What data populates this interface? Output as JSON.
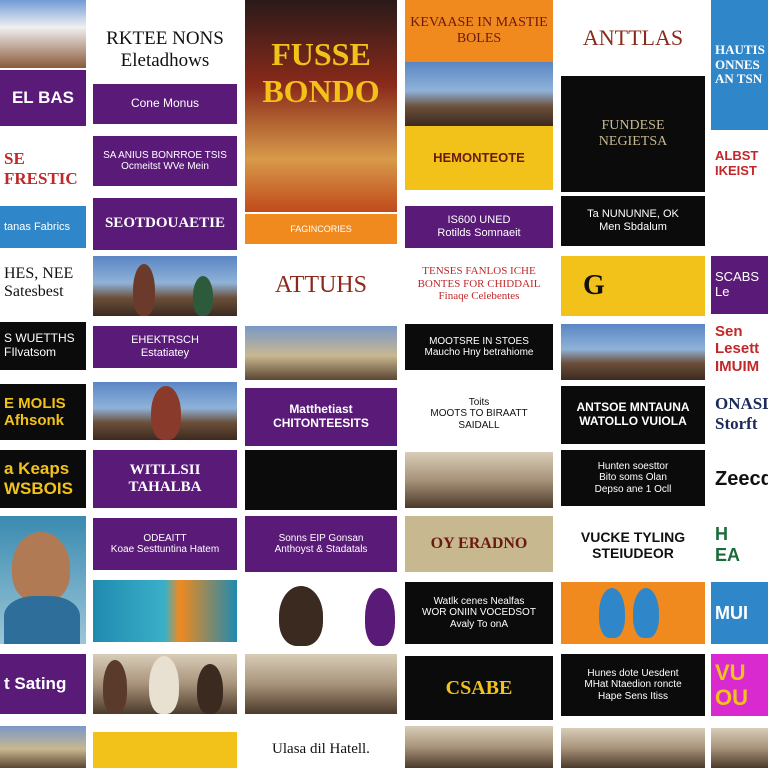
{
  "colors": {
    "purple": "#5a1a78",
    "black": "#0b0b0b",
    "orange": "#f08a1e",
    "yellow": "#f2c21a",
    "blue": "#2f86c8",
    "white": "#ffffff",
    "magenta": "#d92ad0"
  },
  "tiles": {
    "c1": [
      "EL BAS",
      "SE\nFRESTIC",
      "tanas Fabrics",
      "HES, NEE\nSatesbest",
      "S WUETTHS\nFIlvatsom",
      "E MOLIS\nAfhsonk",
      "a Keaps\nWSBOIS",
      "",
      "t Sating",
      ""
    ],
    "c2": [
      "RKTEE NONS\nEletadhows",
      "Cone Monus",
      "SA ANIUS BONRROE TSIS\nOcmeitst WVe Mein",
      "SEOTDOUAETIE",
      "",
      "EHEKTRSCH\nEstatiatey",
      "",
      "WITLLSII TAHALBA",
      "ODEAITT\nKoae Sesttuntina Hatem",
      "",
      "",
      ""
    ],
    "c3": [
      "FUSSE\nBONDO",
      "FAGINCORIES",
      "ATTUHS",
      "",
      "Matthetiast\nCHITONTEESITS",
      "",
      "Sonns EIP Gonsan\nAnthoyst & Stadatals",
      "",
      "Ulasa dil Hatell."
    ],
    "c4": [
      "KEVAASE IN MASTIE\nBOLES",
      "HEMONTEOTE",
      "IS600 UNED\nRotilds Somnaeit",
      "TENSES FANLOS ICHE\nBONTES FOR CHIDDAIL\nFinaqe Celebentes",
      "MOOTSRE IN STOES\nMaucho Hny betrahiome",
      "Toits\nMOOTS TO BIRAATT\nSAIDALL",
      "",
      "OY ERADNO",
      "Watlk cenes Nealfas\nWOR ONIIN VOCEDSOT\nAvaly To onA",
      "CSABE",
      ""
    ],
    "c5": [
      "ANTTLAS",
      "FUNDESE\nNEGIETSA",
      "Ta NUNUNNE, OK\nMen Sbdalum",
      "G",
      "",
      "ANTSOE MNTAUNA\nWATOLLO VUIOLA",
      "Hunten soesttor\nBito soms Olan\nDepso ane 1 Ocll",
      "VUCKE TYLING\nSTEIUDEOR",
      "",
      "Hunes dote Uesdent\nMHat Ntaedion roncte\nHape Sens Itiss",
      ""
    ],
    "c6": [
      "HAUTIS\nONNES\nAN TSN",
      "ALBST\nIKEIST",
      "SCABS\nLe",
      "Sen Lesett\nIMUIM",
      "ONASLS\nStorft",
      "Zeecd",
      "H\nEA",
      "MUI",
      "VU\nOU",
      ""
    ]
  }
}
